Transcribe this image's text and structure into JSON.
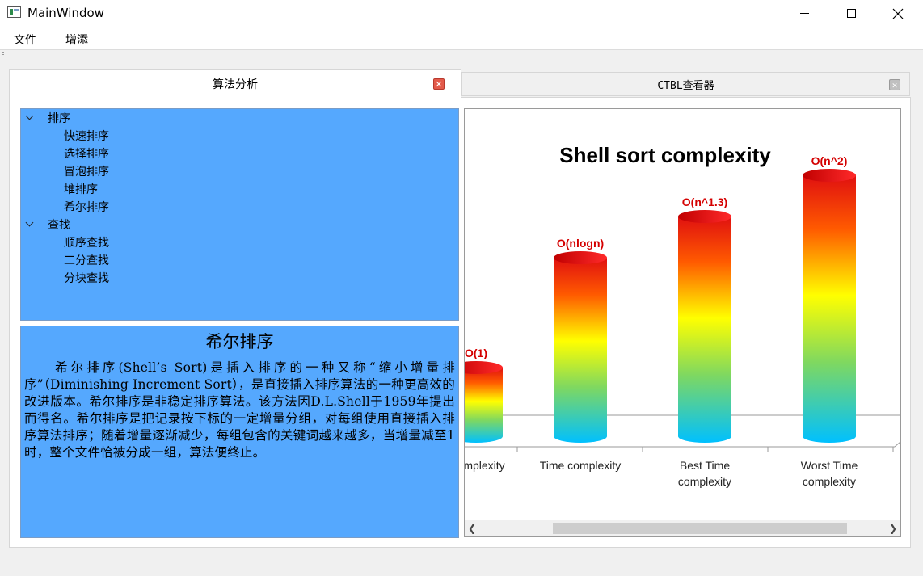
{
  "window": {
    "title": "MainWindow"
  },
  "menu": {
    "file": "文件",
    "add": "增添"
  },
  "tabs": [
    {
      "label": "算法分析",
      "active": true
    },
    {
      "label": "CTBL查看器",
      "active": false
    }
  ],
  "tree": {
    "groups": [
      {
        "label": "排序",
        "children": [
          "快速排序",
          "选择排序",
          "冒泡排序",
          "堆排序",
          "希尔排序"
        ]
      },
      {
        "label": "查找",
        "children": [
          "顺序查找",
          "二分查找",
          "分块查找"
        ]
      }
    ]
  },
  "description": {
    "title": "希尔排序",
    "body": "希尔排序(Shell’s Sort)是插入排序的一种又称“缩小增量排序”（Diminishing Increment Sort），是直接插入排序算法的一种更高效的改进版本。希尔排序是非稳定排序算法。该方法因D.L.Shell于1959年提出而得名。希尔排序是把记录按下标的一定增量分组，对每组使用直接插入排序算法排序；随着增量逐渐减少，每组包含的关键词越来越多，当增量减至1时，整个文件恰被分成一组，算法便终止。"
  },
  "chart_data": {
    "type": "bar",
    "title": "Shell sort complexity",
    "categories": [
      "Space complexity",
      "Time  complexity",
      "Best Time complexity",
      "Worst Time complexity"
    ],
    "visible_category_text": [
      "mplexity",
      "Time  complexity",
      "Best Time complexity",
      "Worst Time complexity"
    ],
    "data_labels": [
      "O(1)",
      "O(nlogn)",
      "O(n^1.3)",
      "O(n^2)"
    ],
    "visible_label_text": [
      "O(1)",
      "O(nlogn)",
      "O(n^1.3)",
      "O(n^2)"
    ],
    "values": [
      1,
      2.6,
      3.2,
      3.8
    ],
    "ylim": [
      0,
      4
    ],
    "label_color": "#d40000",
    "gradient_colors": [
      "#e01010",
      "#ffff00",
      "#00c0ff"
    ],
    "grid": false,
    "legend": "none"
  },
  "colors": {
    "panel": "#55a8fe",
    "close_active": "#e35a4a",
    "close_inactive": "#c0c0c0"
  }
}
